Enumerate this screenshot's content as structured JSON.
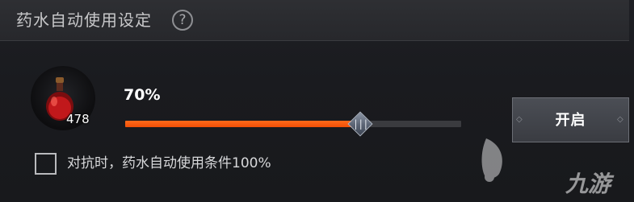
{
  "settings": {
    "title": "药水自动使用设定",
    "help_icon": "?"
  },
  "potion": {
    "icon": "red-potion-icon",
    "count": "478"
  },
  "threshold": {
    "label": "70%",
    "value_percent": 70,
    "thumb_grip": "|||"
  },
  "pvp_option": {
    "checked": false,
    "label": "对抗时，药水自动使用条件100%"
  },
  "toggle": {
    "label": "开启"
  },
  "watermark": {
    "text": "九游"
  },
  "colors": {
    "accent": "#f25a10",
    "track": "#3a3b3f",
    "title_bar": "#2b2c30"
  }
}
